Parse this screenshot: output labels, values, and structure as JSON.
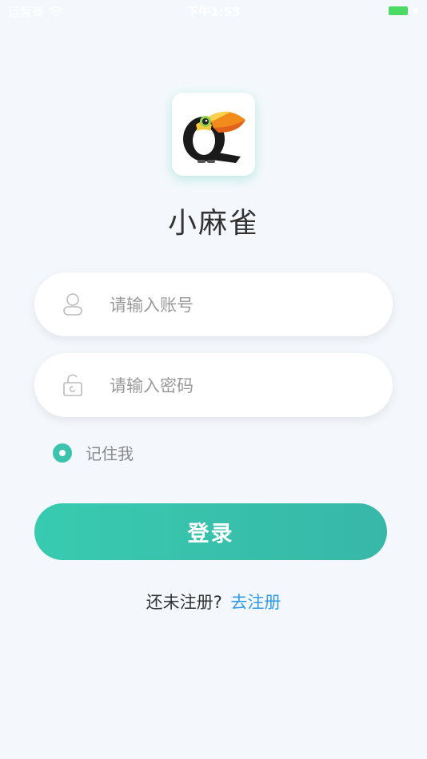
{
  "status_bar": {
    "carrier": "运营商",
    "time": "下午1:53"
  },
  "app": {
    "title": "小麻雀",
    "logo_icon": "toucan-logo-icon"
  },
  "form": {
    "account": {
      "placeholder": "请输入账号",
      "value": "",
      "icon": "user-icon"
    },
    "password": {
      "placeholder": "请输入密码",
      "value": "",
      "icon": "lock-icon"
    },
    "remember": {
      "label": "记住我",
      "checked": true
    },
    "login_label": "登录"
  },
  "register": {
    "prompt": "还未注册?",
    "link": "去注册"
  },
  "colors": {
    "accent": "#3cc3ad",
    "link": "#2f9be8",
    "background": "#f4f8fc"
  }
}
